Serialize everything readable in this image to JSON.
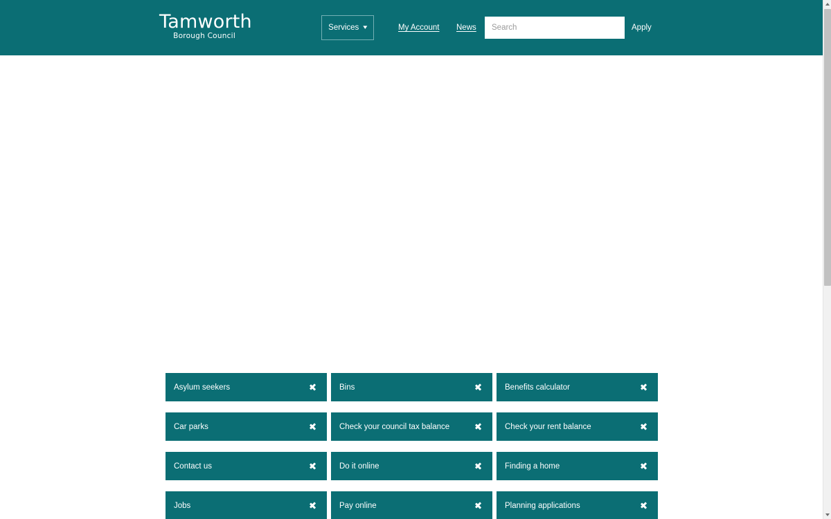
{
  "header": {
    "logo": {
      "main": "Tamworth",
      "sub": "Borough Council"
    },
    "services_button": {
      "label": "Services",
      "caret_icon": "chevron-down-icon"
    },
    "links": [
      {
        "label": "My Account"
      },
      {
        "label": "News"
      }
    ],
    "search": {
      "placeholder": "Search",
      "value": ""
    },
    "apply_button": {
      "label": "Apply"
    },
    "background_color": "#0b6e74"
  },
  "quick_links": {
    "chevron_icon": "chevron-right-icon",
    "background_color": "#0b6e74",
    "items": [
      {
        "label": "Asylum seekers"
      },
      {
        "label": "Bins"
      },
      {
        "label": "Benefits calculator"
      },
      {
        "label": "Car parks"
      },
      {
        "label": "Check your council tax balance"
      },
      {
        "label": "Check your rent balance"
      },
      {
        "label": "Contact us"
      },
      {
        "label": "Do it online"
      },
      {
        "label": "Finding a home"
      },
      {
        "label": "Jobs"
      },
      {
        "label": "Pay online"
      },
      {
        "label": "Planning applications"
      }
    ]
  },
  "scrollbar": {
    "up_icon": "scroll-up-arrow-icon",
    "down_icon": "scroll-down-arrow-icon"
  }
}
